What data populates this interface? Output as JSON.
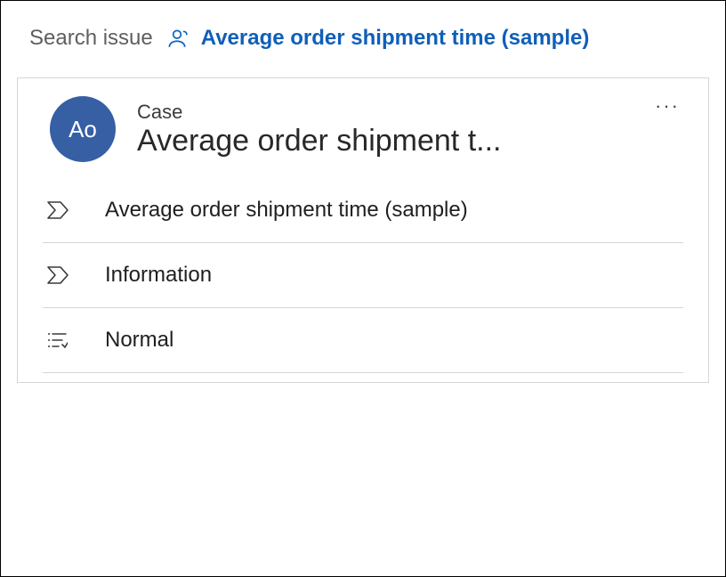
{
  "breadcrumb": {
    "back_label": "Search issue",
    "current_label": "Average order shipment time (sample)"
  },
  "card": {
    "avatar_initials": "Ao",
    "type_label": "Case",
    "title_truncated": "Average order shipment t...",
    "rows": [
      {
        "icon": "chevron",
        "text": "Average order shipment time (sample)"
      },
      {
        "icon": "chevron",
        "text": "Information"
      },
      {
        "icon": "priority",
        "text": "Normal"
      }
    ]
  }
}
